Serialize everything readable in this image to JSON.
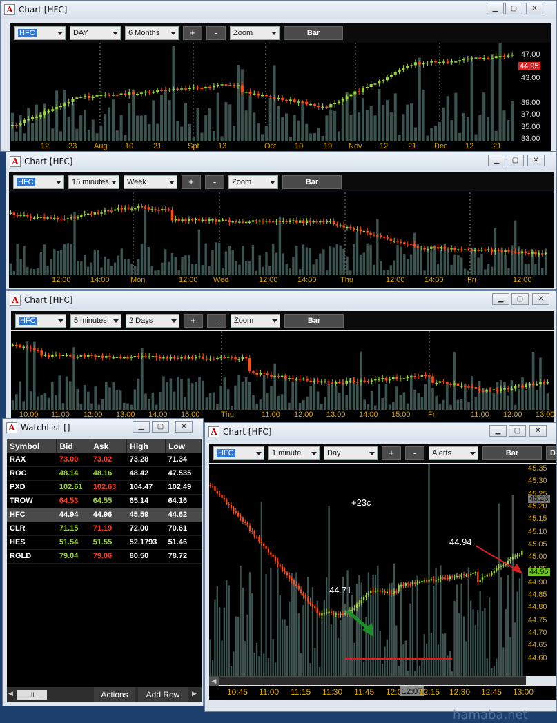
{
  "window1": {
    "title": "Chart [HFC]",
    "symbol": "HFC",
    "interval": "DAY",
    "range": "6 Months",
    "plus": "+",
    "minus": "-",
    "zoom": "Zoom",
    "bar": "Bar",
    "y_ticks": [
      "47.00",
      "43.00",
      "39.00",
      "37.00",
      "35.00",
      "33.00"
    ],
    "price_tag": "44.95",
    "x_labels": [
      "12",
      "23",
      "Aug",
      "10",
      "21",
      "Spt",
      "13",
      "Oct",
      "10",
      "19",
      "Nov",
      "12",
      "21",
      "Dec",
      "12",
      "21"
    ]
  },
  "window2": {
    "title": "Chart [HFC]",
    "symbol": "HFC",
    "interval": "15 minutes",
    "range": "Week",
    "plus": "+",
    "minus": "-",
    "zoom": "Zoom",
    "bar": "Bar",
    "x_labels": [
      "12:00",
      "14:00",
      "Mon",
      "12:00",
      "Wed",
      "12:00",
      "14:00",
      "Thu",
      "12:00",
      "14:00",
      "Fri",
      "12:00"
    ]
  },
  "window3": {
    "title": "Chart [HFC]",
    "symbol": "HFC",
    "interval": "5 minutes",
    "range": "2 Days",
    "plus": "+",
    "minus": "-",
    "zoom": "Zoom",
    "bar": "Bar",
    "x_labels": [
      "10:00",
      "11:00",
      "12:00",
      "13:00",
      "14:00",
      "15:00",
      "Thu",
      "11:00",
      "12:00",
      "13:00",
      "14:00",
      "15:00",
      "Fri",
      "11:00",
      "12:00",
      "13:00"
    ]
  },
  "window4": {
    "title": "Chart [HFC]",
    "symbol": "HFC",
    "interval": "1 minute",
    "range": "Day",
    "plus": "+",
    "minus": "-",
    "alerts": "Alerts",
    "bar": "Bar",
    "extra_button": "D",
    "y_ticks": [
      "45.35",
      "45.30",
      "45.25",
      "45.20",
      "45.15",
      "45.10",
      "45.05",
      "45.00",
      "44.95",
      "44.90",
      "44.85",
      "44.80",
      "44.75",
      "44.70",
      "44.65",
      "44.60"
    ],
    "price_tag_grey": "45.23",
    "price_tag_green": "44.95",
    "annotation_change": "+23c",
    "annotation_low": "44.71",
    "annotation_last": "44.94",
    "x_labels": [
      "10:45",
      "11:00",
      "11:15",
      "11:30",
      "11:45",
      "12:00",
      "12:15",
      "12:30",
      "12:45",
      "13:00"
    ],
    "cursor_time": "12:07"
  },
  "watchlist": {
    "title": "WatchList []",
    "columns": [
      "Symbol",
      "Bid",
      "Ask",
      "High",
      "Low"
    ],
    "rows": [
      {
        "symbol": "RAX",
        "bid": "73.00",
        "ask": "73.02",
        "high": "73.28",
        "low": "71.34",
        "bid_dir": "dn",
        "ask_dir": "dn"
      },
      {
        "symbol": "ROC",
        "bid": "48.14",
        "ask": "48.16",
        "high": "48.42",
        "low": "47.535",
        "bid_dir": "up",
        "ask_dir": "up"
      },
      {
        "symbol": "PXD",
        "bid": "102.61",
        "ask": "102.63",
        "high": "104.47",
        "low": "102.49",
        "bid_dir": "up",
        "ask_dir": "dn"
      },
      {
        "symbol": "TROW",
        "bid": "64.53",
        "ask": "64.55",
        "high": "65.14",
        "low": "64.16",
        "bid_dir": "dn",
        "ask_dir": "up"
      },
      {
        "symbol": "HFC",
        "bid": "44.94",
        "ask": "44.96",
        "high": "45.59",
        "low": "44.62",
        "bid_dir": "",
        "ask_dir": ""
      },
      {
        "symbol": "CLR",
        "bid": "71.15",
        "ask": "71.19",
        "high": "72.00",
        "low": "70.61",
        "bid_dir": "up",
        "ask_dir": "dn"
      },
      {
        "symbol": "HES",
        "bid": "51.54",
        "ask": "51.55",
        "high": "52.1793",
        "low": "51.46",
        "bid_dir": "up",
        "ask_dir": "up"
      },
      {
        "symbol": "RGLD",
        "bid": "79.04",
        "ask": "79.06",
        "high": "80.50",
        "low": "78.72",
        "bid_dir": "up",
        "ask_dir": "dn"
      }
    ],
    "actions_label": "Actions",
    "add_row_label": "Add Row",
    "scroll_thumb": "III"
  },
  "watermark": "hamaba.net",
  "colors": {
    "up": "#9bd33c",
    "down": "#ff4a12",
    "volume": "#3b5450",
    "price_tag_red": "#e02020",
    "price_tag_green": "#6fc21b"
  }
}
